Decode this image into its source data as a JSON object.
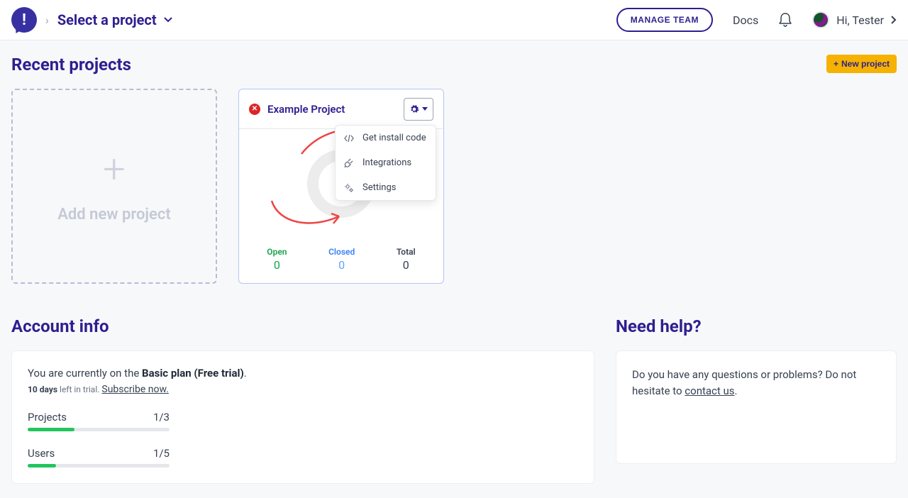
{
  "header": {
    "project_selector": "Select a project",
    "manage_team": "MANAGE TEAM",
    "docs": "Docs",
    "user_greeting": "Hi, Tester"
  },
  "recent": {
    "title": "Recent projects",
    "new_project": "New project",
    "add_card": "Add new project",
    "project": {
      "name": "Example Project",
      "stats": {
        "open_label": "Open",
        "open_value": "0",
        "closed_label": "Closed",
        "closed_value": "0",
        "total_label": "Total",
        "total_value": "0"
      },
      "menu": {
        "install": "Get install code",
        "integrations": "Integrations",
        "settings": "Settings"
      }
    }
  },
  "account": {
    "title": "Account info",
    "line1_prefix": "You are currently on the ",
    "line1_plan": "Basic plan (Free trial)",
    "line1_suffix": ".",
    "line2_days": "10 days",
    "line2_rest": " left in trial. ",
    "subscribe": "Subscribe now.",
    "projects_label": "Projects",
    "projects_value": "1/3",
    "users_label": "Users",
    "users_value": "1/5"
  },
  "help": {
    "title": "Need help?",
    "text_prefix": "Do you have any questions or problems? Do not hesitate to ",
    "link": "contact us",
    "text_suffix": "."
  }
}
